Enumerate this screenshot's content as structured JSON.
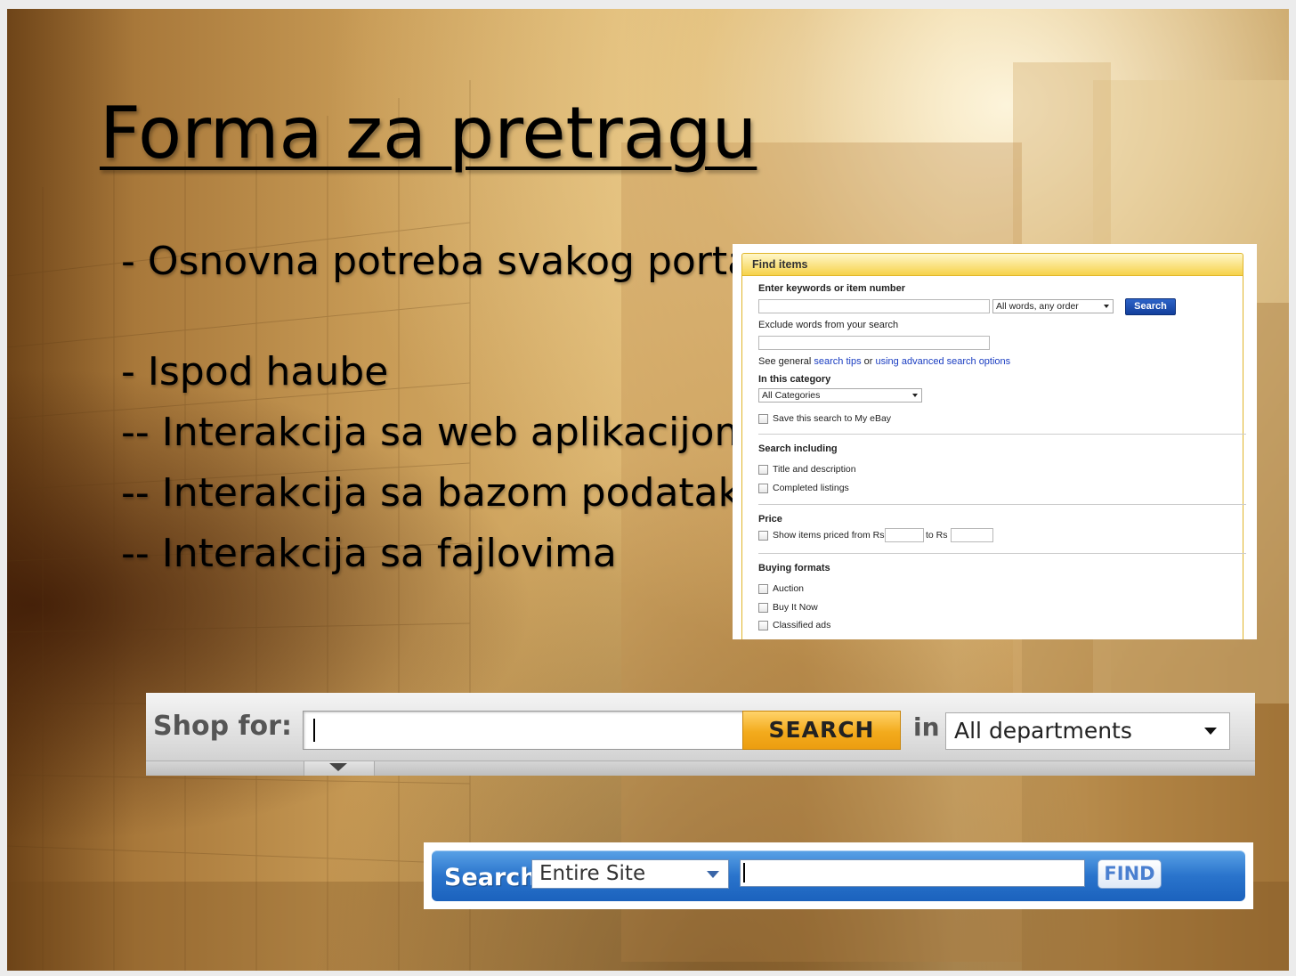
{
  "slide": {
    "title": "Forma za pretragu",
    "bullets": [
      "- Osnovna potreba svakog portala",
      "- Ispod haube",
      "-- Interakcija sa web aplikacijom",
      "-- Interakcija sa bazom podataka",
      "-- Interakcija sa fajlovima"
    ]
  },
  "ebay_form": {
    "header": "Find items",
    "keywords_label": "Enter keywords or item number",
    "keywords_value": "",
    "match_select": "All words, any order",
    "search_button": "Search",
    "exclude_label": "Exclude words from your search",
    "exclude_value": "",
    "tips_prefix": "See general",
    "tips_link": "search tips",
    "tips_or": "or",
    "advanced_link": "using advanced search options",
    "category_label": "In this category",
    "category_select": "All Categories",
    "save_search": "Save this search to My eBay",
    "search_including_label": "Search including",
    "title_and_description": "Title and description",
    "completed_listings": "Completed listings",
    "price_label": "Price",
    "price_from": "Show items priced from Rs",
    "price_to": "to Rs",
    "buying_formats_label": "Buying formats",
    "auction": "Auction",
    "buy_it_now": "Buy It Now",
    "classified_ads": "Classified ads"
  },
  "shop_bar": {
    "label": "Shop for:",
    "input_value": "",
    "search_button": "SEARCH",
    "in_label": "in",
    "department_select": "All departments"
  },
  "blue_bar": {
    "label": "Search",
    "scope_select": "Entire Site",
    "input_value": "",
    "find_button": "FIND"
  },
  "colors": {
    "ebay_header": "#f6d24a",
    "ebay_button": "#1c4bb0",
    "shop_search_button": "#f3ab1d",
    "blue_bar": "#2a74cc"
  }
}
